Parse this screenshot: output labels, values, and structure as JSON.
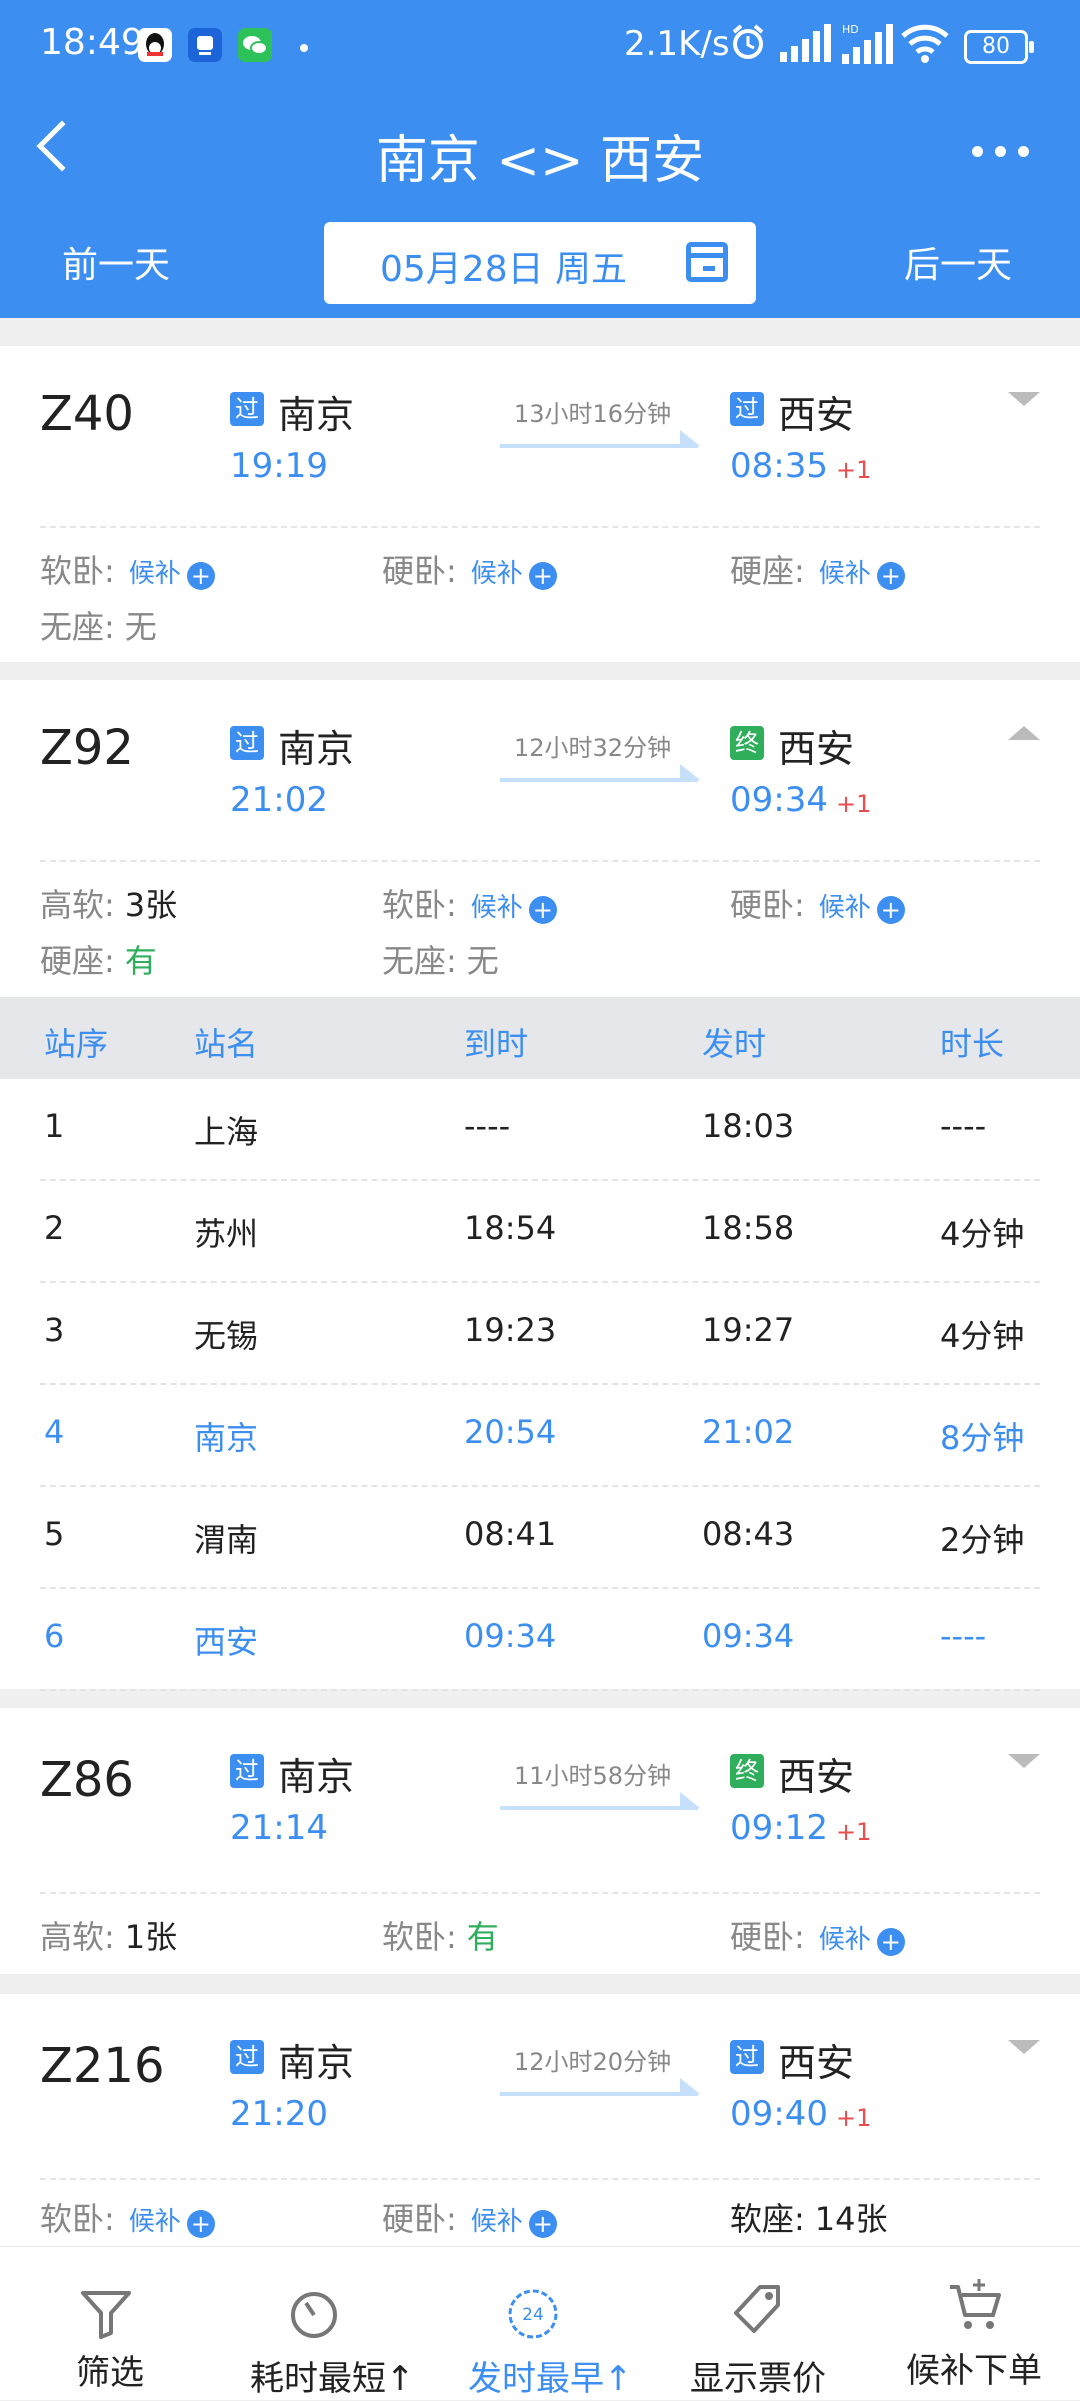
{
  "status": {
    "time": "18:49",
    "speed": "2.1K/s",
    "battery": "80",
    "net": "HD"
  },
  "header": {
    "title": "南京 <> 西安",
    "prev_day": "前一天",
    "next_day": "后一天",
    "date": "05月28日 周五"
  },
  "trains": [
    {
      "number": "Z40",
      "from_badge": "过",
      "from": "南京",
      "dep": "19:19",
      "duration": "13小时16分钟",
      "to_badge": "过",
      "to": "西安",
      "arr": "08:35",
      "plus": "+1",
      "expanded": false,
      "seats": [
        {
          "label": "软卧:",
          "value": "候补",
          "action": "+"
        },
        {
          "label": "硬卧:",
          "value": "候补",
          "action": "+"
        },
        {
          "label": "硬座:",
          "value": "候补",
          "action": "+"
        },
        {
          "label": "无座:",
          "value": "无"
        }
      ]
    },
    {
      "number": "Z92",
      "from_badge": "过",
      "from": "南京",
      "dep": "21:02",
      "duration": "12小时32分钟",
      "to_badge": "终",
      "to": "西安",
      "arr": "09:34",
      "plus": "+1",
      "expanded": true,
      "seats": [
        {
          "label": "高软:",
          "value": "3张"
        },
        {
          "label": "软卧:",
          "value": "候补",
          "action": "+"
        },
        {
          "label": "硬卧:",
          "value": "候补",
          "action": "+"
        },
        {
          "label": "硬座:",
          "value": "有"
        },
        {
          "label": "无座:",
          "value": "无"
        }
      ]
    },
    {
      "number": "Z86",
      "from_badge": "过",
      "from": "南京",
      "dep": "21:14",
      "duration": "11小时58分钟",
      "to_badge": "终",
      "to": "西安",
      "arr": "09:12",
      "plus": "+1",
      "expanded": false,
      "seats": [
        {
          "label": "高软:",
          "value": "1张"
        },
        {
          "label": "软卧:",
          "value": "有"
        },
        {
          "label": "硬卧:",
          "value": "候补",
          "action": "+"
        }
      ]
    },
    {
      "number": "Z216",
      "from_badge": "过",
      "from": "南京",
      "dep": "21:20",
      "duration": "12小时20分钟",
      "to_badge": "过",
      "to": "西安",
      "arr": "09:40",
      "plus": "+1",
      "expanded": false,
      "seats": [
        {
          "label": "软卧:",
          "value": "候补",
          "action": "+"
        },
        {
          "label": "硬卧:",
          "value": "候补",
          "action": "+"
        },
        {
          "label": "软座:",
          "value": "14张"
        }
      ]
    }
  ],
  "stops_table": {
    "headers": [
      "站序",
      "站名",
      "到时",
      "发时",
      "时长"
    ],
    "rows": [
      [
        "1",
        "上海",
        "----",
        "18:03",
        "----"
      ],
      [
        "2",
        "苏州",
        "18:54",
        "18:58",
        "4分钟"
      ],
      [
        "3",
        "无锡",
        "19:23",
        "19:27",
        "4分钟"
      ],
      [
        "4",
        "南京",
        "20:54",
        "21:02",
        "8分钟"
      ],
      [
        "5",
        "渭南",
        "08:41",
        "08:43",
        "2分钟"
      ],
      [
        "6",
        "西安",
        "09:34",
        "09:34",
        "----"
      ]
    ],
    "highlighted_rows": [
      3,
      5
    ]
  },
  "bottom_nav": [
    {
      "label": "筛选",
      "icon": "filter-icon"
    },
    {
      "label": "耗时最短↑",
      "icon": "stopwatch-icon"
    },
    {
      "label": "发时最早↑",
      "icon": "clock-24-icon",
      "active": true,
      "icon_text": "24"
    },
    {
      "label": "显示票价",
      "icon": "price-tag-icon"
    },
    {
      "label": "候补下单",
      "icon": "cart-icon"
    }
  ],
  "colors": {
    "primary": "#3c8ef0",
    "green": "#2fae5c",
    "red": "#e94c4c",
    "gray": "#888888"
  }
}
